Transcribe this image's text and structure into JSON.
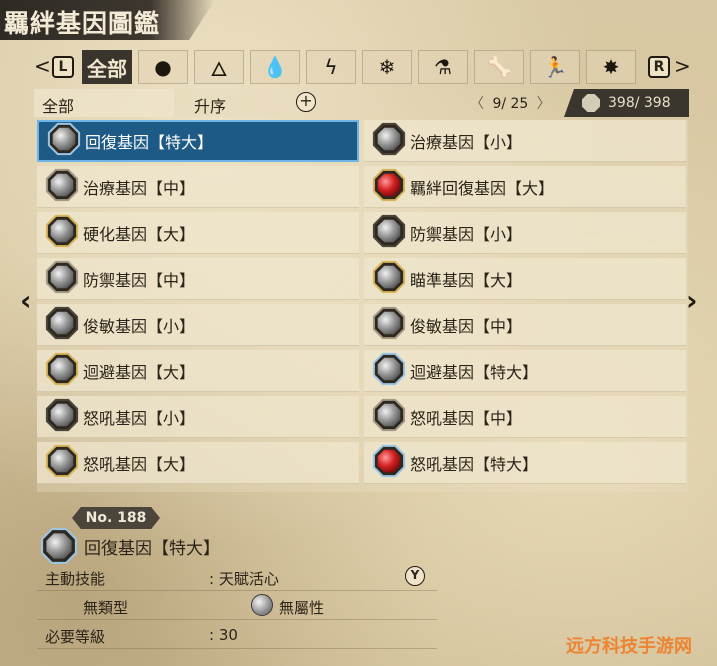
{
  "window": {
    "title": "羈絆基因圖鑑"
  },
  "tabs": {
    "left_key": "L",
    "right_key": "R",
    "left_arrow": "<",
    "right_arrow": ">",
    "items": [
      {
        "label": "全部",
        "icon": "all-text",
        "active": true
      },
      {
        "label": "●",
        "icon": "non-elemental-icon",
        "active": false
      },
      {
        "label": "🜂",
        "icon": "fire-icon",
        "active": false
      },
      {
        "label": "💧",
        "icon": "water-icon",
        "active": false
      },
      {
        "label": "ϟ",
        "icon": "thunder-icon",
        "active": false
      },
      {
        "label": "❄",
        "icon": "ice-icon",
        "active": false
      },
      {
        "label": "⚗",
        "icon": "dragon-icon",
        "active": false
      },
      {
        "label": "🦴",
        "icon": "status-icon",
        "active": false
      },
      {
        "label": "🏃",
        "icon": "move-icon",
        "active": false
      },
      {
        "label": "✸",
        "icon": "burst-icon",
        "active": false
      }
    ]
  },
  "subheader": {
    "filter": "全部",
    "sort": "升序",
    "plus": "+",
    "page_prev": "〈",
    "page_text": "9/ 25",
    "page_next": "〉",
    "count_text": "398/ 398"
  },
  "grid": {
    "left": [
      {
        "label": "回復基因【特大】",
        "gem": "silver",
        "frame": "blue",
        "selected": true
      },
      {
        "label": "治療基因【中】",
        "gem": "silver",
        "frame": "gray",
        "selected": false
      },
      {
        "label": "硬化基因【大】",
        "gem": "silver",
        "frame": "gold",
        "selected": false
      },
      {
        "label": "防禦基因【中】",
        "gem": "silver",
        "frame": "gray",
        "selected": false
      },
      {
        "label": "俊敏基因【小】",
        "gem": "silver",
        "frame": "dark",
        "selected": false
      },
      {
        "label": "迴避基因【大】",
        "gem": "silver",
        "frame": "gold",
        "selected": false
      },
      {
        "label": "怒吼基因【小】",
        "gem": "silver",
        "frame": "dark",
        "selected": false
      },
      {
        "label": "怒吼基因【大】",
        "gem": "silver",
        "frame": "gold",
        "selected": false
      }
    ],
    "right": [
      {
        "label": "治療基因【小】",
        "gem": "silver",
        "frame": "dark",
        "selected": false
      },
      {
        "label": "羈絆回復基因【大】",
        "gem": "red",
        "frame": "gold",
        "selected": false
      },
      {
        "label": "防禦基因【小】",
        "gem": "silver",
        "frame": "dark",
        "selected": false
      },
      {
        "label": "瞄準基因【大】",
        "gem": "silver",
        "frame": "gold",
        "selected": false
      },
      {
        "label": "俊敏基因【中】",
        "gem": "silver",
        "frame": "gray",
        "selected": false
      },
      {
        "label": "迴避基因【特大】",
        "gem": "silver",
        "frame": "blue",
        "selected": false
      },
      {
        "label": "怒吼基因【中】",
        "gem": "silver",
        "frame": "gray",
        "selected": false
      },
      {
        "label": "怒吼基因【特大】",
        "gem": "red",
        "frame": "blue",
        "selected": false
      }
    ],
    "prev_arrow": "‹",
    "next_arrow": "›"
  },
  "detail": {
    "number": "No. 188",
    "name": "回復基因【特大】",
    "rows": {
      "skill_label": "主動技能",
      "skill_value": ": 天賦活心",
      "y_button": "Y",
      "type_label": "無類型",
      "attr_text": "無屬性",
      "level_label": "必要等級",
      "level_value": ": 30"
    }
  },
  "watermark": "远方科技手游网",
  "colors": {
    "selected_bg": "#1e5a86",
    "selected_border": "#6eb6e8",
    "panel_dark": "#3a352d",
    "gem_red": "#d42020"
  }
}
